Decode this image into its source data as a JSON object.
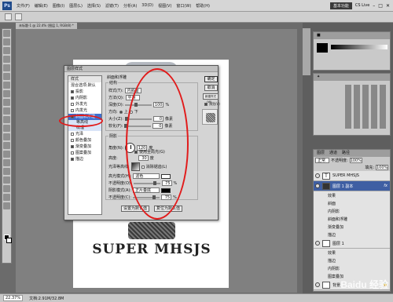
{
  "menubar": {
    "logo": "Ps",
    "items": [
      "文件(F)",
      "编辑(E)",
      "图像(I)",
      "图层(L)",
      "选择(S)",
      "滤镜(T)",
      "分析(A)",
      "3D(D)",
      "视图(V)",
      "窗口(W)",
      "帮助(H)"
    ],
    "workspace": "基本功能",
    "cs_live": "CS Live"
  },
  "document": {
    "tab": "未标题-1 @ 22.4% (图层 1, RGB/8) *"
  },
  "artwork": {
    "title": "SUPER MHSJS"
  },
  "status": {
    "zoom": "22.37%",
    "doc": "文档:2.91M/32.8M"
  },
  "layers_panel": {
    "tabs": [
      "图层",
      "通道",
      "路径"
    ],
    "blend_mode": "正常",
    "opacity_label": "不透明度:",
    "opacity": "100%",
    "fill_label": "填充:",
    "fill": "100%",
    "layers": [
      {
        "name": "SUPER MHSJS",
        "type": "text"
      },
      {
        "name": "图层 1 副本",
        "selected": true
      },
      {
        "name": "图层 1"
      },
      {
        "name": "背景"
      }
    ],
    "effects_label": "效果",
    "fx_items_a": [
      "斜面",
      "内阴影",
      "斜面和浮雕",
      "渐变叠加",
      "描边"
    ],
    "fx_items_b": [
      "效果",
      "描边",
      "内阴影",
      "图案叠加",
      "颜色叠加",
      "描边"
    ]
  },
  "dialog": {
    "title": "图层样式",
    "styles_header": "样式",
    "blend_options": "混合选项:默认",
    "styles": [
      {
        "label": "投影",
        "checked": true
      },
      {
        "label": "内阴影",
        "checked": true
      },
      {
        "label": "外发光",
        "checked": false
      },
      {
        "label": "内发光",
        "checked": false
      },
      {
        "label": "斜面和浮雕",
        "checked": true,
        "selected": true
      },
      {
        "label": "等高线",
        "sub": true
      },
      {
        "label": "纹理",
        "sub": true
      },
      {
        "label": "光泽",
        "checked": false
      },
      {
        "label": "颜色叠加",
        "checked": false
      },
      {
        "label": "渐变叠加",
        "checked": true
      },
      {
        "label": "图案叠加",
        "checked": false
      },
      {
        "label": "描边",
        "checked": true
      }
    ],
    "section_title": "斜面和浮雕",
    "structure": {
      "title": "结构",
      "style_label": "样式(T):",
      "style_value": "内斜面",
      "technique_label": "方法(Q):",
      "technique_value": "平滑",
      "depth_label": "深度(D):",
      "depth_value": "100",
      "direction_label": "方向:",
      "dir_up": "上",
      "dir_down": "下",
      "size_label": "大小(Z):",
      "size_value": "0",
      "soften_label": "软化(F):",
      "soften_value": "0",
      "unit_px": "像素",
      "unit_pct": "%"
    },
    "shading": {
      "title": "阴影",
      "angle_label": "角度(N):",
      "angle_value": "120",
      "global_light": "使用全局光(G)",
      "altitude_label": "高度:",
      "altitude_value": "30",
      "degree": "度",
      "gloss_label": "光泽等高线:",
      "antialias": "消除锯齿(L)",
      "highlight_label": "高光模式(H):",
      "highlight_value": "滤色",
      "hl_opacity_label": "不透明度(O):",
      "hl_opacity_value": "75",
      "shadow_label": "阴影模式(A):",
      "shadow_value": "正片叠底",
      "sh_opacity_label": "不透明度(C):",
      "sh_opacity_value": "75"
    },
    "buttons": {
      "ok": "确定",
      "cancel": "取消",
      "new_style": "新建样式(W)...",
      "preview": "预览(V)",
      "set_default": "设置为默认值",
      "reset_default": "复位为默认值"
    },
    "colors": {
      "highlight": "#ffffff",
      "shadow": "#000000"
    }
  },
  "watermark": "Baidu 经验",
  "colors": {
    "accent": "#3f6fcf",
    "annotation": "#e11b1b"
  }
}
